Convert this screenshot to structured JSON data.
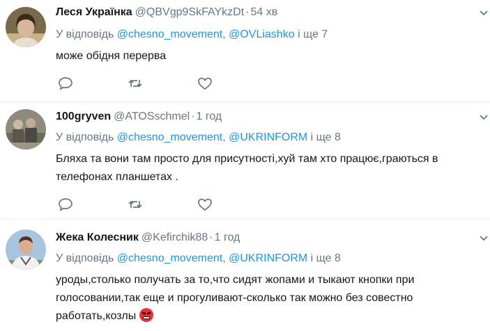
{
  "tweets": [
    {
      "name": "Леся Українка",
      "handle": "@QBVgp9SkFAYkzDt",
      "time": "54 хв",
      "reply_prefix": "У відповідь",
      "mention1": "@chesno_movement",
      "mention2": "@OVLiashko",
      "reply_suffix": "і ще 7",
      "text": "може обідня перерва",
      "avatar": "woman-portrait"
    },
    {
      "name": "100gryven",
      "handle": "@ATOSschmel",
      "time": "1 год",
      "reply_prefix": "У відповідь",
      "mention1": "@chesno_movement",
      "mention2": "@UKRINFORM",
      "reply_suffix": "і ще 8",
      "text": "Бляха та вони там просто для присутності,хуй там хто працює,граються в телефонах планшетах .",
      "avatar": "group-photo"
    },
    {
      "name": "Жека Колесник",
      "handle": "@Kefirchik88",
      "time": "1 год",
      "reply_prefix": "У відповідь",
      "mention1": "@chesno_movement",
      "mention2": "@UKRINFORM",
      "reply_suffix": "і ще 8",
      "text": "уроды,столько получать за то,что сидят жопами и тыкают кнопки при голосовании,так еще и прогуливают-сколько так можно без совестно работать,козлы",
      "avatar": "man-portrait"
    }
  ],
  "separators": {
    "dot": "·",
    "comma": ","
  },
  "icons": {
    "reply": "reply-icon",
    "retweet": "retweet-icon",
    "like": "heart-icon",
    "more": "chevron-down-icon",
    "emoji": "angry-face-emoji"
  },
  "colors": {
    "text": "#14171a",
    "secondary": "#657786",
    "link": "#1b95e0",
    "divider": "#e6ecf0"
  }
}
